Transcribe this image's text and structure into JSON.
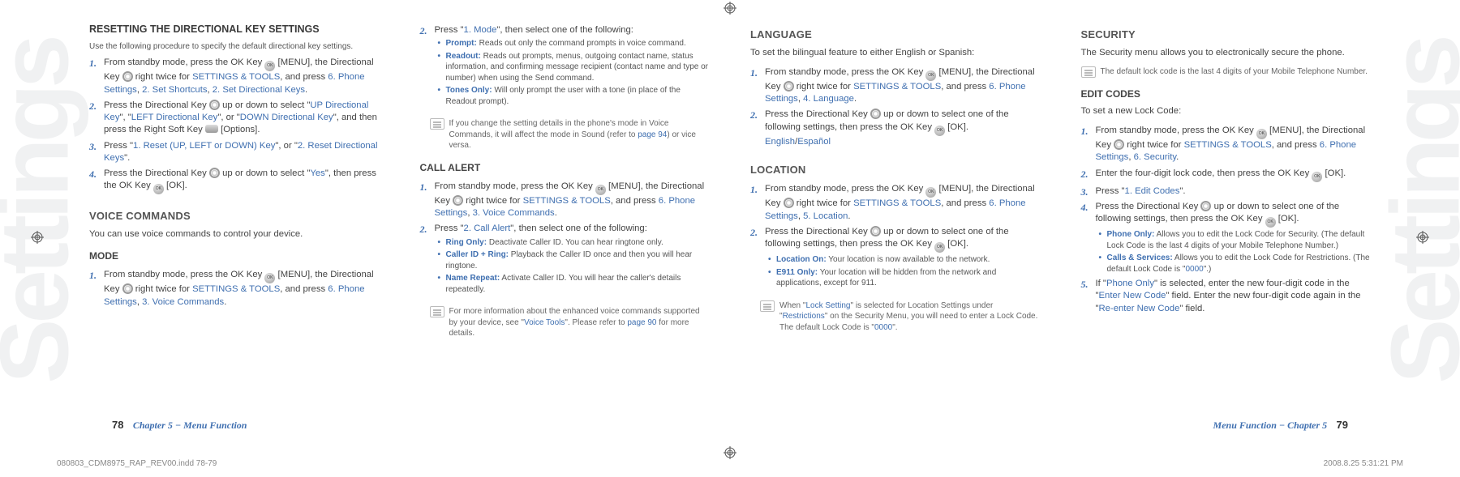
{
  "watermark": "Settings",
  "col1": {
    "heading": "RESETTING THE DIRECTIONAL KEY SETTINGS",
    "lead": "Use the following procedure to specify the default directional key settings.",
    "s1a": "From standby mode, press the OK Key ",
    "s1b": " [MENU], the Directional Key ",
    "s1c": " right twice for ",
    "s1link1": "SETTINGS & TOOLS",
    "s1mid": ", and press ",
    "s1link2": "6. Phone Settings",
    "s1comma": ", ",
    "s1link3": "2. Set Shortcuts",
    "s1link4": "2. Set Directional Keys",
    "s1end": ".",
    "s2a": "Press the Directional Key ",
    "s2b": " up or down to select \"",
    "s2up": "UP Directional Key",
    "s2mid1": "\", \"",
    "s2left": "LEFT Directional Key",
    "s2mid2": "\", or \"",
    "s2down": "DOWN Directional Key",
    "s2c": "\", and then press the Right Soft Key ",
    "s2opt": " [Options].",
    "s3a": "Press \"",
    "s3opt1": "1. Reset (UP, LEFT or DOWN) Key",
    "s3mid": "\", or \"",
    "s3opt2": "2. Reset Directional Keys",
    "s3end": "\".",
    "s4a": "Press the Directional Key ",
    "s4b": " up or down to select \"",
    "s4yes": "Yes",
    "s4c": "\", then press the OK Key ",
    "s4ok": " [OK].",
    "voice_h": "VOICE COMMANDS",
    "voice_lead": "You can use voice commands to control your device.",
    "mode_h": "MODE",
    "m1a": "From standby mode, press the OK Key ",
    "m1b": " [MENU], the Directional Key ",
    "m1c": " right twice for ",
    "m1link1": "SETTINGS & TOOLS",
    "m1mid": ", and press ",
    "m1link2": "6. Phone Settings",
    "m1comma": ", ",
    "m1link3": "3. Voice Commands",
    "m1end": "."
  },
  "col2": {
    "s2a": "Press \"",
    "s2mode": "1. Mode",
    "s2b": "\", then select one of the following:",
    "b_prompt_l": "Prompt:",
    "b_prompt_t": "  Reads out only the command prompts in voice command.",
    "b_readout_l": "Readout:",
    "b_readout_t": "  Reads out prompts, menus, outgoing contact name, status information, and confirming message recipient (contact name and type or number) when using the Send command.",
    "b_tones_l": "Tones Only:",
    "b_tones_t": "  Will only prompt the user with a tone (in place of the Readout prompt).",
    "note1a": "If you change the setting details in the phone's mode in Voice Commands, it will affect the mode in Sound (refer to ",
    "note1pg": "page 94",
    "note1b": ") or vice versa.",
    "call_h": "CALL ALERT",
    "c1a": "From standby mode, press the OK Key ",
    "c1b": " [MENU], the Directional Key ",
    "c1c": " right twice for ",
    "c1link1": "SETTINGS & TOOLS",
    "c1mid": ", and press ",
    "c1link2": "6. Phone Settings",
    "c1comma": ", ",
    "c1link3": "3. Voice Commands",
    "c1end": ".",
    "c2a": "Press \"",
    "c2link": "2. Call Alert",
    "c2b": "\", then select one of the following:",
    "b_ring_l": "Ring Only:",
    "b_ring_t": "  Deactivate Caller ID. You can hear ringtone only.",
    "b_cid_l": "Caller ID + Ring:",
    "b_cid_t": "  Playback the Caller ID once and then you will hear ringtone.",
    "b_name_l": "Name Repeat:",
    "b_name_t": "  Activate Caller ID. You will hear the caller's details repeatedly.",
    "note2a": "For more information about the enhanced voice commands supported by your device, see \"",
    "note2link": "Voice Tools",
    "note2b": "\". Please refer to ",
    "note2pg": "page 90",
    "note2c": " for more details."
  },
  "col3": {
    "lang_h": "LANGUAGE",
    "lang_lead": "To set the bilingual feature to either English or Spanish:",
    "l1a": "From standby mode, press the OK Key ",
    "l1b": " [MENU], the Directional Key ",
    "l1c": " right twice for ",
    "l1link1": "SETTINGS & TOOLS",
    "l1mid": ", and press ",
    "l1link2": "6. Phone Settings",
    "l1comma": ", ",
    "l1link3": "4. Language",
    "l1end": ".",
    "l2a": "Press the Directional Key ",
    "l2b": " up or down to select one of the following settings, then press the OK Key ",
    "l2ok": " [OK].",
    "l2opts_a": "English",
    "l2slash": "/",
    "l2opts_b": "Español",
    "loc_h": "LOCATION",
    "lo1a": "From standby mode, press the OK Key ",
    "lo1b": " [MENU], the Directional Key ",
    "lo1c": " right twice for ",
    "lo1link1": "SETTINGS & TOOLS",
    "lo1mid": ", and press ",
    "lo1link2": "6. Phone Settings",
    "lo1comma": ", ",
    "lo1link3": "5. Location",
    "lo1end": ".",
    "lo2a": "Press the Directional Key ",
    "lo2b": " up or down to select one of the following settings, then press the OK Key ",
    "lo2ok": " [OK].",
    "b_lon_l": "Location On:",
    "b_lon_t": "  Your location is now available to the network.",
    "b_e911_l": "E911 Only:",
    "b_e911_t": "  Your location will be hidden from the network and applications, except for 911.",
    "note3a": "When \"",
    "note3link1": "Lock Setting",
    "note3b": "\" is selected for Location Settings under \"",
    "note3link2": "Restrictions",
    "note3c": "\" on the Security Menu, you will need to enter a Lock Code. The default Lock Code is \"",
    "note3code": "0000",
    "note3d": "\"."
  },
  "col4": {
    "sec_h": "SECURITY",
    "sec_lead": "The Security menu allows you to electronically secure the phone.",
    "note4": "The default lock code is the last 4 digits of your Mobile Telephone Number.",
    "edit_h": "EDIT CODES",
    "edit_lead": "To set a new Lock Code:",
    "e1a": "From standby mode, press the OK Key ",
    "e1b": " [MENU], the Directional Key ",
    "e1c": " right twice for ",
    "e1link1": "SETTINGS & TOOLS",
    "e1mid": ", and press ",
    "e1link2": "6. Phone Settings",
    "e1comma": ", ",
    "e1link3": "6. Security",
    "e1end": ".",
    "e2a": "Enter the four-digit lock code, then press the OK Key ",
    "e2ok": " [OK].",
    "e3a": "Press \"",
    "e3link": "1. Edit Codes",
    "e3b": "\".",
    "e4a": "Press the Directional Key ",
    "e4b": " up or down to select one of the following settings, then press the OK Key ",
    "e4ok": " [OK].",
    "b_phone_l": "Phone Only:",
    "b_phone_t": "  Allows you to edit the Lock Code for Security. (The default Lock Code is the last 4 digits of your Mobile Telephone Number.)",
    "b_calls_l": "Calls & Services:",
    "b_calls_t1": "  Allows you to edit the Lock Code for Restrictions. (The default Lock Code is \"",
    "b_calls_code": "0000",
    "b_calls_t2": "\".)",
    "e5a": "If \"",
    "e5link1": "Phone Only",
    "e5b": "\" is selected, enter the new four-digit code in the \"",
    "e5link2": "Enter New Code",
    "e5c": "\" field. Enter the new four-digit code again in the \"",
    "e5link3": "Re-enter New Code",
    "e5d": "\" field."
  },
  "footer": {
    "left_pg": "78",
    "left_ch": "Chapter 5 − Menu Function",
    "right_ch": "Menu Function − Chapter 5",
    "right_pg": "79",
    "file": "080803_CDM8975_RAP_REV00.indd   78-79",
    "ts": "2008.8.25   5:31:21 PM"
  }
}
